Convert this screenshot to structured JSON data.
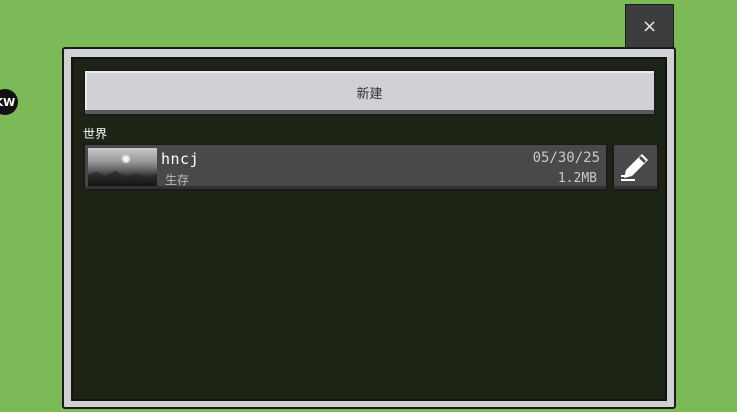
{
  "avatar": {
    "text": "KW"
  },
  "close_button": {
    "glyph": "×"
  },
  "create_button": {
    "label": "新建"
  },
  "section": {
    "label": "世界"
  },
  "worlds": [
    {
      "name": "hncj",
      "mode": "生存",
      "date": "05/30/25",
      "size": "1.2MB",
      "thumbnail_icon": "world-thumbnail"
    }
  ],
  "edit_button": {
    "icon": "pencil-icon"
  },
  "colors": {
    "background": "#7cba57",
    "panel": "#d0d1d4",
    "panel_inner": "#1e2415",
    "row": "#48494a",
    "close_button": "#3c3c3f"
  }
}
